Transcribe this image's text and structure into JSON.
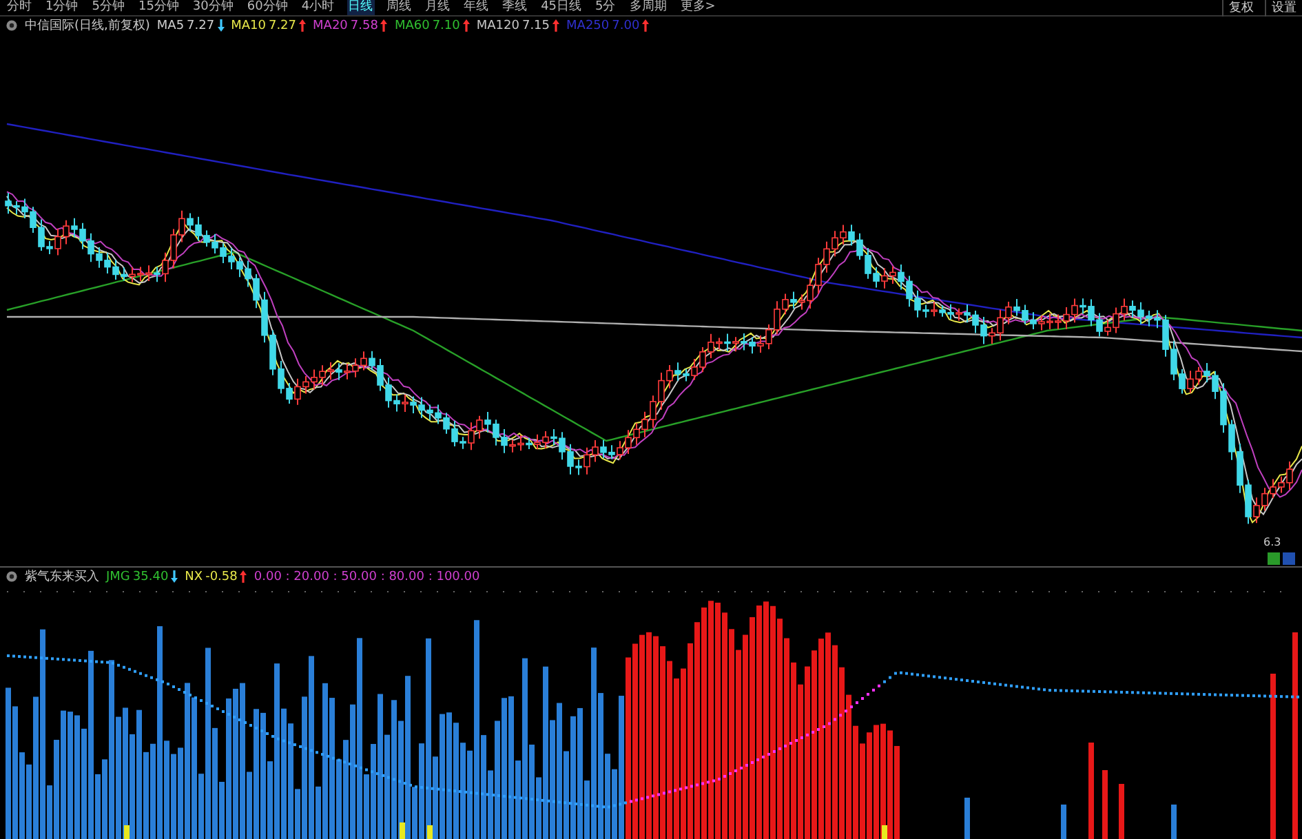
{
  "toolbar": {
    "tabs": [
      {
        "label": "分时",
        "selected": false
      },
      {
        "label": "1分钟",
        "selected": false
      },
      {
        "label": "5分钟",
        "selected": false
      },
      {
        "label": "15分钟",
        "selected": false
      },
      {
        "label": "30分钟",
        "selected": false
      },
      {
        "label": "60分钟",
        "selected": false
      },
      {
        "label": "4小时",
        "selected": false
      },
      {
        "label": "日线",
        "selected": true
      },
      {
        "label": "周线",
        "selected": false
      },
      {
        "label": "月线",
        "selected": false
      },
      {
        "label": "年线",
        "selected": false
      },
      {
        "label": "季线",
        "selected": false
      },
      {
        "label": "45日线",
        "selected": false
      },
      {
        "label": "5分",
        "selected": false
      },
      {
        "label": "多周期",
        "selected": false
      },
      {
        "label": "更多>",
        "selected": false
      }
    ],
    "right_buttons": [
      "复权",
      "设置"
    ]
  },
  "main_chart": {
    "title": "中信国际(日线,前复权)",
    "indicators": [
      {
        "name": "MA5",
        "value": "7.27",
        "rising": false,
        "color": "#d0d0d0"
      },
      {
        "name": "MA10",
        "value": "7.27",
        "rising": true,
        "color": "#e8e84a"
      },
      {
        "name": "MA20",
        "value": "7.58",
        "rising": true,
        "color": "#d040d0"
      },
      {
        "name": "MA60",
        "value": "7.10",
        "rising": true,
        "color": "#30c030"
      },
      {
        "name": "MA120",
        "value": "7.15",
        "rising": true,
        "color": "#c8c8c8"
      },
      {
        "name": "MA250",
        "value": "7.00",
        "rising": true,
        "color": "#3030d0"
      }
    ],
    "low_price_label": "6.3"
  },
  "lower_panel": {
    "title": "紫气东来买入",
    "indicators": [
      {
        "name": "JMG",
        "value": "35.40",
        "rising": false,
        "color": "#30c030"
      },
      {
        "name": "NX",
        "value": "-0.58",
        "rising": true,
        "color": "#e8e84a"
      }
    ],
    "levels": "0.00 : 20.00 : 50.00 : 80.00 : 100.00"
  }
}
